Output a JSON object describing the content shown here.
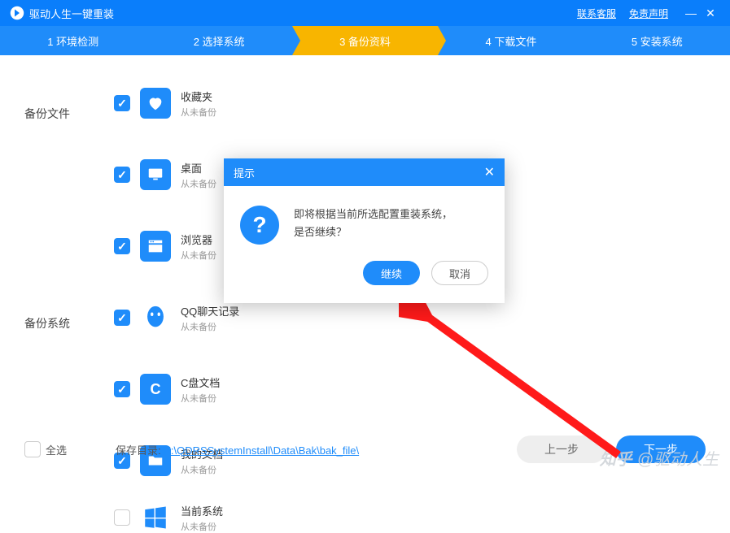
{
  "titlebar": {
    "title": "驱动人生一键重装",
    "links": {
      "support": "联系客服",
      "disclaimer": "免责声明"
    }
  },
  "steps": [
    "1 环境检测",
    "2 选择系统",
    "3 备份资料",
    "4 下载文件",
    "5 安装系统"
  ],
  "section": {
    "files": "备份文件",
    "system": "备份系统"
  },
  "items": [
    {
      "name": "收藏夹",
      "status": "从未备份",
      "icon": "heart",
      "checked": true
    },
    {
      "name": "桌面",
      "status": "从未备份",
      "icon": "desktop",
      "checked": true
    },
    {
      "name": "浏览器",
      "status": "从未备份",
      "icon": "browser",
      "checked": true
    },
    {
      "name": "QQ聊天记录",
      "status": "从未备份",
      "icon": "qq",
      "checked": true
    },
    {
      "name": "C盘文档",
      "status": "从未备份",
      "icon": "cdrive",
      "checked": true
    },
    {
      "name": "我的文档",
      "status": "从未备份",
      "icon": "docs",
      "checked": true
    }
  ],
  "system_item": {
    "name": "当前系统",
    "status": "从未备份",
    "checked": false
  },
  "bottom": {
    "select_all": "全选",
    "save_label": "保存目录:",
    "save_path": "E:\\QDRSSystemInstall\\Data\\Bak\\bak_file\\",
    "prev": "上一步",
    "next": "下一步"
  },
  "modal": {
    "title": "提示",
    "line1": "即将根据当前所选配置重装系统，",
    "line2": "是否继续？",
    "continue": "继续",
    "cancel": "取消"
  },
  "watermark": {
    "zhihu": "知乎",
    "author": "@驱动人生"
  }
}
